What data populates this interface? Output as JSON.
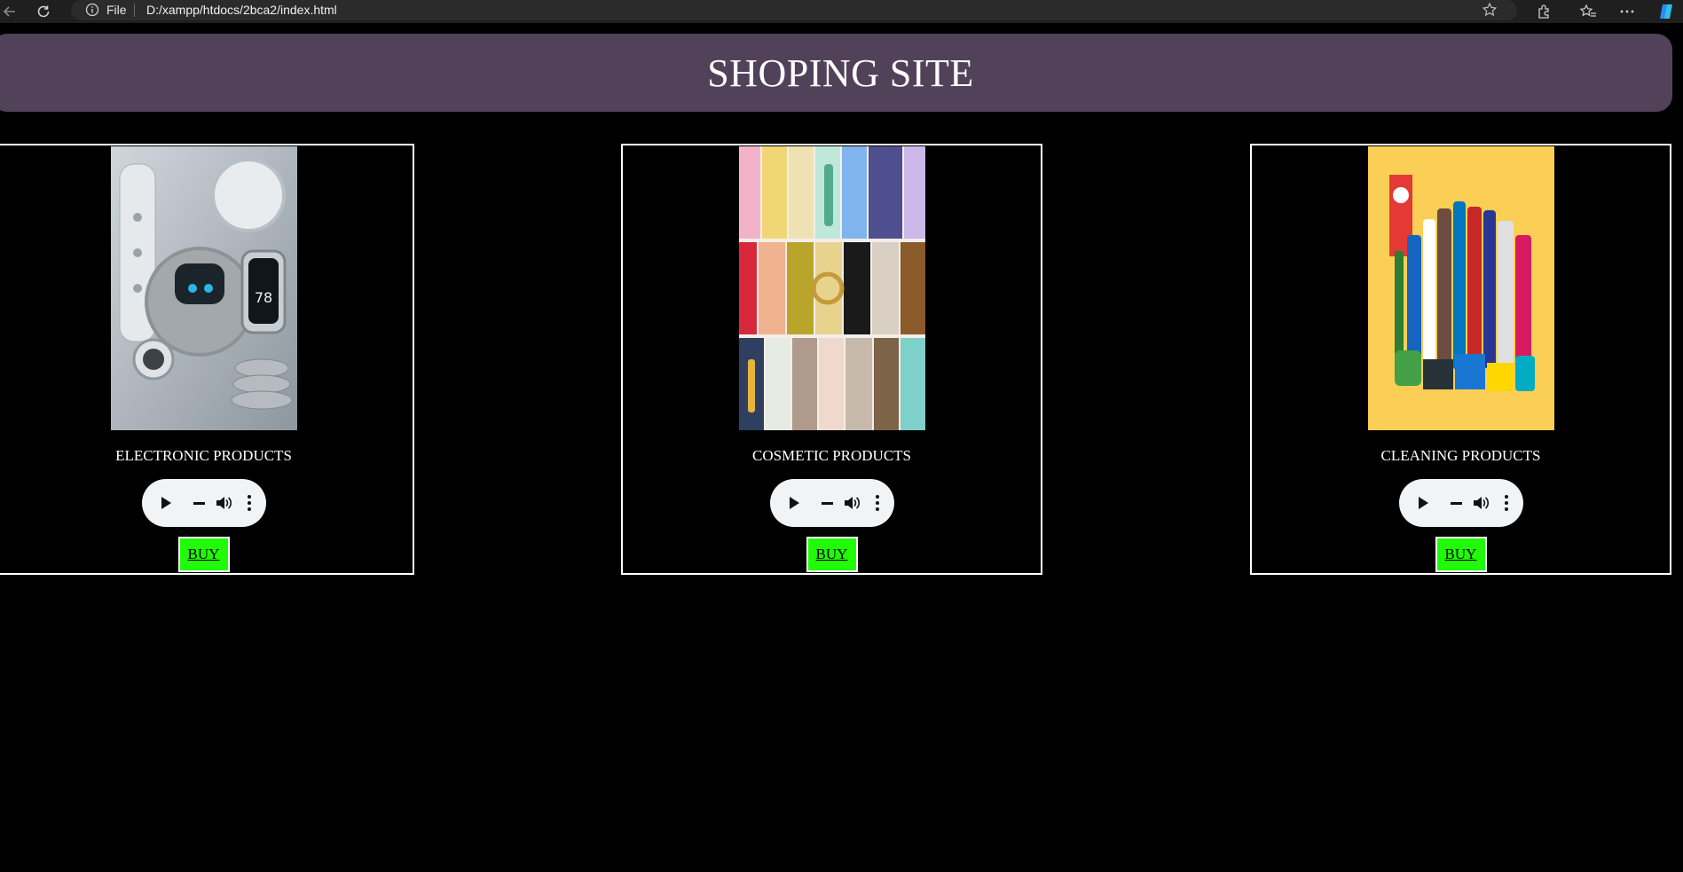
{
  "browser": {
    "scheme_label": "File",
    "url": "D:/xampp/htdocs/2bca2/index.html",
    "icons": [
      "back-arrow-icon",
      "refresh-icon",
      "info-icon",
      "star-icon",
      "extensions-icon",
      "favorites-icon",
      "more-icon",
      "copilot-icon"
    ]
  },
  "header": {
    "title": "SHOPING SITE",
    "bg_color": "#514259"
  },
  "products": [
    {
      "name": "ELECTRONIC PRODUCTS",
      "buy_label": "BUY",
      "image": "smart-home-devices"
    },
    {
      "name": "COSMETIC PRODUCTS",
      "buy_label": "BUY",
      "image": "cosmetics-collage"
    },
    {
      "name": "CLEANING PRODUCTS",
      "buy_label": "BUY",
      "image": "cleaning-supplies"
    }
  ],
  "colors": {
    "page_bg": "#000000",
    "buy_bg": "#21fa08",
    "player_bg": "#f1f3f4"
  }
}
